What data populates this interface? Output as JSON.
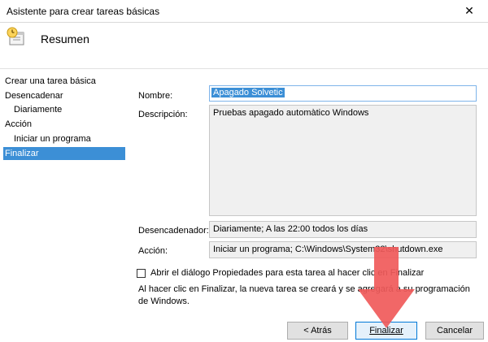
{
  "window": {
    "title": "Asistente para crear tareas básicas",
    "close_glyph": "✕"
  },
  "header": {
    "title": "Resumen",
    "icon": "task-clock-icon"
  },
  "nav": {
    "items": [
      {
        "label": "Crear una tarea básica",
        "selected": false
      },
      {
        "label": "Desencadenar",
        "selected": false
      },
      {
        "label": "Diariamente",
        "selected": false
      },
      {
        "label": "Acción",
        "selected": false
      },
      {
        "label": "Iniciar un programa",
        "selected": false
      },
      {
        "label": "Finalizar",
        "selected": true
      }
    ]
  },
  "form": {
    "name_label": "Nombre:",
    "name_value": "Apagado Solvetic",
    "description_label": "Descripción:",
    "description_value": "Pruebas apagado automàtico Windows",
    "trigger_label": "Desencadenador:",
    "trigger_value": "Diariamente; A las 22:00 todos los días",
    "action_label": "Acción:",
    "action_value": "Iniciar un programa; C:\\Windows\\System32\\shutdown.exe"
  },
  "checkbox": {
    "label": "Abrir el diálogo Propiedades para esta tarea al hacer clic en Finalizar",
    "checked": false
  },
  "info_text": "Al hacer clic en Finalizar, la nueva tarea se creará y se agregará a su programación de Windows.",
  "buttons": {
    "back_label": "< Atrás",
    "finish_label": "Finalizar",
    "cancel_label": "Cancelar"
  },
  "colors": {
    "selection": "#3c8fd6",
    "arrow": "#f05a5a"
  }
}
